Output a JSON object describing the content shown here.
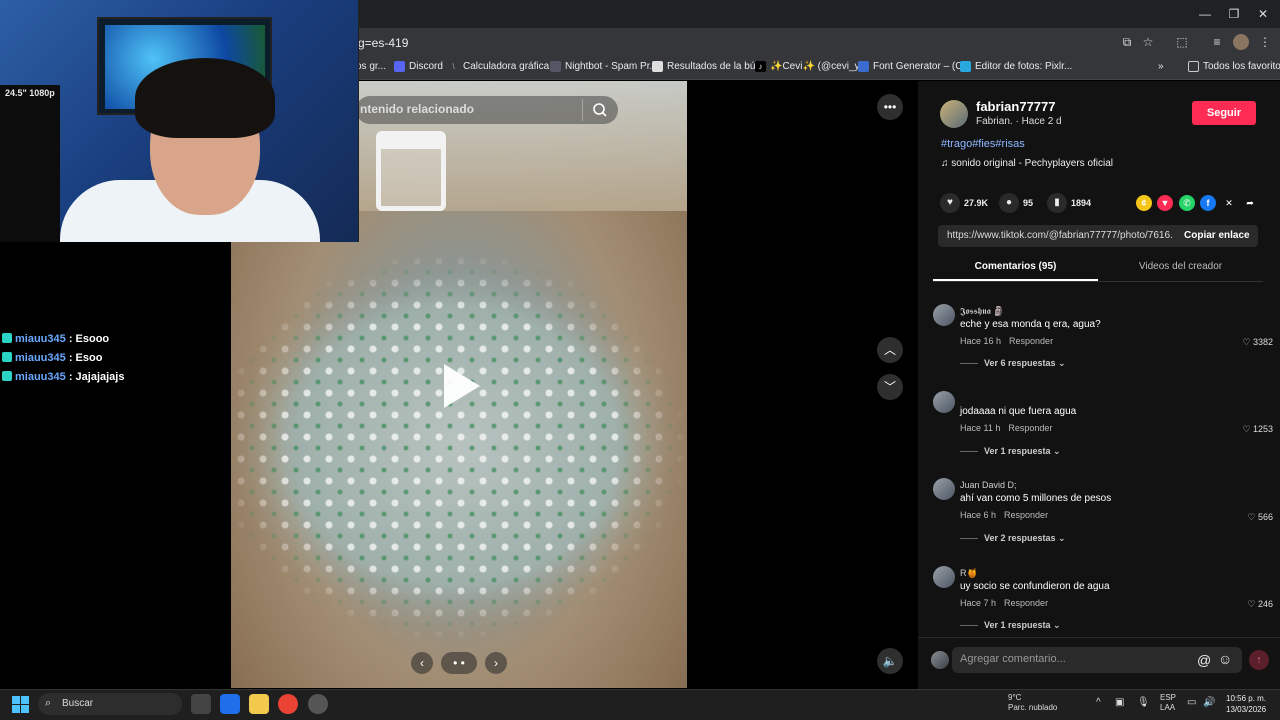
{
  "browser": {
    "url_fragment": "g=es-419",
    "bookmarks": [
      {
        "label": "os gr...",
        "icon": "bookmark-icon"
      },
      {
        "label": "Discord",
        "icon": "discord-icon"
      },
      {
        "label": "Calculadora gráfica...",
        "icon": "calculator-icon"
      },
      {
        "label": "Nightbot - Spam Pr...",
        "icon": "nightbot-icon"
      },
      {
        "label": "Resultados de la bú...",
        "icon": "search-result-icon"
      },
      {
        "label": "✨Cevi✨ (@cevi_y...",
        "icon": "tiktok-icon"
      },
      {
        "label": "Font Generator – (C...",
        "icon": "font-icon"
      },
      {
        "label": "Editor de fotos: Pixlr...",
        "icon": "pixlr-icon"
      }
    ],
    "all_favorites": "Todos los favoritos"
  },
  "video": {
    "search_placeholder": "ntenido relacionado",
    "nav_prev": "‹",
    "nav_dots": "• •",
    "nav_next": "›"
  },
  "post": {
    "username": "fabrian77777",
    "subline": "Fabrian. · Hace 2 d",
    "follow_label": "Seguir",
    "hashtags": "#trago#fies#risas",
    "sound": "sonido original - Pechyplayers oficial",
    "likes": "27.9K",
    "comments_count": "95",
    "saves": "1894",
    "link": "https://www.tiktok.com/@fabrian77777/photo/7616...",
    "copy_label": "Copiar enlace",
    "tab_comments": "Comentarios (95)",
    "tab_creator": "Videos del creador"
  },
  "comments": [
    {
      "user": "𝕵𝖔𝖘𝖘𝖍𝖚𝖆 🗿",
      "text": "eche y esa monda q era, agua?",
      "time": "Hace 16 h",
      "reply": "Responder",
      "likes": "3382",
      "more": "Ver 6 respuestas ⌄"
    },
    {
      "user": "",
      "text": "jodaaaa ni que fuera agua",
      "time": "Hace 11 h",
      "reply": "Responder",
      "likes": "1253",
      "more": "Ver 1 respuesta ⌄"
    },
    {
      "user": "Juan David D;",
      "text": "ahí van como 5 millones de pesos",
      "time": "Hace 6 h",
      "reply": "Responder",
      "likes": "566",
      "more": "Ver 2 respuestas ⌄"
    },
    {
      "user": "R🍯",
      "text": "uy socio se confundieron de agua",
      "time": "Hace 7 h",
      "reply": "Responder",
      "likes": "246",
      "more": "Ver 1 respuesta ⌄"
    }
  ],
  "comment_input": {
    "placeholder": "Agregar comentario..."
  },
  "chat": [
    {
      "user": "miauu345",
      "message": ": Esooo"
    },
    {
      "user": "miauu345",
      "message": ": Esoo"
    },
    {
      "user": "miauu345",
      "message": ": Jajajajajs"
    }
  ],
  "webcam": {
    "pc_label": "24.5\"\n1080p"
  },
  "taskbar": {
    "search_label": "Buscar",
    "weather_temp": "9°C",
    "weather_desc": "Parc. nublado",
    "lang": "ESP",
    "layout": "LAA",
    "time": "10:56 p. m.",
    "date": "13/03/2026"
  }
}
